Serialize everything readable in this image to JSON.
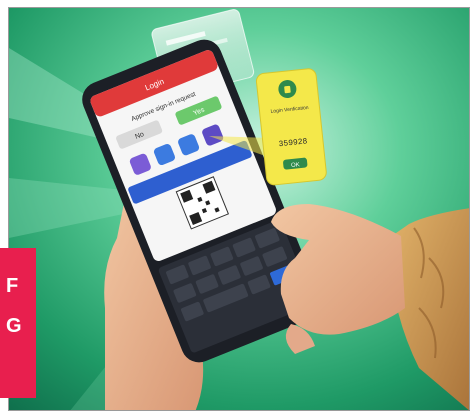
{
  "badge": {
    "line1": "F",
    "line2": "G"
  },
  "phone_screen": {
    "header_title": "Login",
    "prompt_text": "Approve sign-in request",
    "deny_label": "No",
    "approve_label": "Yes"
  },
  "auth_card": {
    "title": "Login Verification",
    "code": "359928",
    "button_label": "OK"
  },
  "colors": {
    "background_green": "#2fae6f",
    "badge": "#e81f4e",
    "card_yellow": "#f4e84a",
    "sleeve": "#c9924a",
    "phone_body": "#1c1f26"
  }
}
